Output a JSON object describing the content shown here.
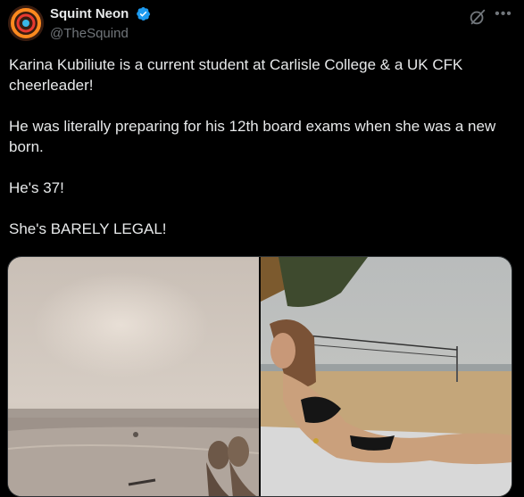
{
  "author": {
    "display_name": "Squint Neon",
    "handle": "@TheSquind",
    "verified": true,
    "avatar_icon": "neon-logo-avatar"
  },
  "actions": {
    "grok_icon": "grok-icon",
    "more_icon": "more-options-icon"
  },
  "tweet": {
    "paragraphs": [
      "Karina Kubiliute is a current student at Carlisle College & a UK CFK cheerleader!",
      "He was literally preparing for his 12th board exams when she was a new born.",
      "He's 37!",
      "She's BARELY LEGAL!"
    ]
  },
  "media": {
    "photos": [
      {
        "description_icon": "beach-sunset-feet-photo"
      },
      {
        "description_icon": "beach-volleyball-bikini-photo"
      }
    ]
  },
  "colors": {
    "background": "#000000",
    "text": "#e7e9ea",
    "secondary_text": "#71767b",
    "verified_blue": "#1d9bf0"
  }
}
